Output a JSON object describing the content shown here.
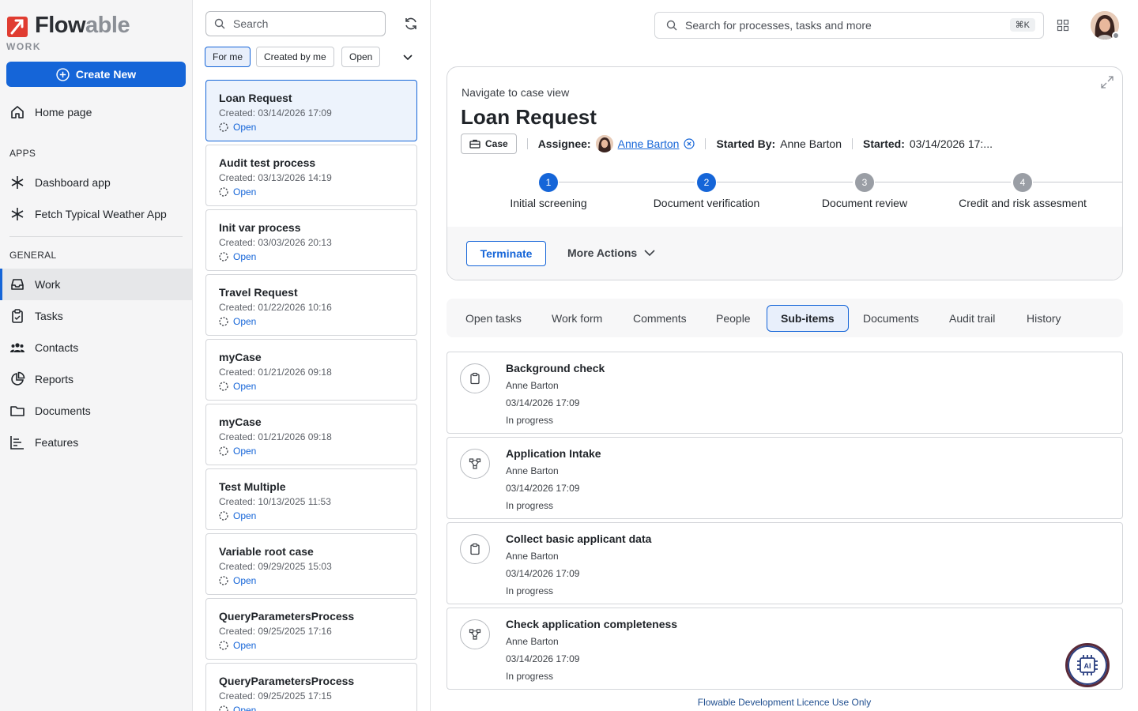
{
  "brand": {
    "name_a": "Flow",
    "name_b": "able",
    "sub": "WORK",
    "color": "#e03c31"
  },
  "sidebar": {
    "create_label": "Create New",
    "home_label": "Home page",
    "apps_heading": "APPS",
    "apps": [
      {
        "label": "Dashboard app"
      },
      {
        "label": "Fetch Typical Weather App"
      }
    ],
    "general_heading": "GENERAL",
    "items": [
      {
        "label": "Work",
        "icon": "inbox-icon",
        "active": true
      },
      {
        "label": "Tasks",
        "icon": "clipboard-icon"
      },
      {
        "label": "Contacts",
        "icon": "people-icon"
      },
      {
        "label": "Reports",
        "icon": "chart-icon"
      },
      {
        "label": "Documents",
        "icon": "folder-icon"
      },
      {
        "label": "Features",
        "icon": "bars-icon"
      }
    ]
  },
  "list": {
    "search_placeholder": "Search",
    "filters": [
      {
        "label": "For me",
        "active": true
      },
      {
        "label": "Created by me"
      },
      {
        "label": "Open"
      }
    ],
    "items": [
      {
        "title": "Loan Request",
        "created": "Created: 03/14/2026 17:09",
        "status": "Open",
        "selected": true
      },
      {
        "title": "Audit test process",
        "created": "Created: 03/13/2026 14:19",
        "status": "Open"
      },
      {
        "title": "Init var process",
        "created": "Created: 03/03/2026 20:13",
        "status": "Open"
      },
      {
        "title": "Travel Request",
        "created": "Created: 01/22/2026 10:16",
        "status": "Open"
      },
      {
        "title": "myCase",
        "created": "Created: 01/21/2026 09:18",
        "status": "Open"
      },
      {
        "title": "myCase",
        "created": "Created: 01/21/2026 09:18",
        "status": "Open"
      },
      {
        "title": "Test Multiple",
        "created": "Created: 10/13/2025 11:53",
        "status": "Open"
      },
      {
        "title": "Variable root case",
        "created": "Created: 09/29/2025 15:03",
        "status": "Open"
      },
      {
        "title": "QueryParametersProcess",
        "created": "Created: 09/25/2025 17:16",
        "status": "Open"
      },
      {
        "title": "QueryParametersProcess",
        "created": "Created: 09/25/2025 17:15",
        "status": "Open"
      }
    ]
  },
  "header": {
    "search_placeholder": "Search for processes, tasks and more",
    "shortcut": "⌘K"
  },
  "case": {
    "nav_label": "Navigate to case view",
    "title": "Loan Request",
    "type_badge": "Case",
    "assignee_label": "Assignee:",
    "assignee": "Anne Barton",
    "started_by_label": "Started By:",
    "started_by": "Anne Barton",
    "started_label": "Started:",
    "started": "03/14/2026 17:...",
    "steps": [
      {
        "num": "1",
        "label": "Initial screening",
        "done": true
      },
      {
        "num": "2",
        "label": "Document verification",
        "done": true
      },
      {
        "num": "3",
        "label": "Document review",
        "done": false
      },
      {
        "num": "4",
        "label": "Credit and risk assesment",
        "done": false
      }
    ],
    "terminate_label": "Terminate",
    "more_actions_label": "More Actions"
  },
  "tabs": [
    {
      "label": "Open tasks"
    },
    {
      "label": "Work form"
    },
    {
      "label": "Comments"
    },
    {
      "label": "People"
    },
    {
      "label": "Sub-items",
      "active": true
    },
    {
      "label": "Documents"
    },
    {
      "label": "Audit trail"
    },
    {
      "label": "History"
    }
  ],
  "subitems": [
    {
      "title": "Background check",
      "user": "Anne Barton",
      "date": "03/14/2026 17:09",
      "status": "In progress",
      "icon": "clipboard-icon"
    },
    {
      "title": "Application Intake",
      "user": "Anne Barton",
      "date": "03/14/2026 17:09",
      "status": "In progress",
      "icon": "process-icon"
    },
    {
      "title": "Collect basic applicant data",
      "user": "Anne Barton",
      "date": "03/14/2026 17:09",
      "status": "In progress",
      "icon": "clipboard-icon"
    },
    {
      "title": "Check application completeness",
      "user": "Anne Barton",
      "date": "03/14/2026 17:09",
      "status": "In progress",
      "icon": "process-icon"
    }
  ],
  "footer": "Flowable Development Licence Use Only",
  "ai_label": "AI",
  "colors": {
    "accent": "#1565d8",
    "brand_red": "#e03c31"
  }
}
